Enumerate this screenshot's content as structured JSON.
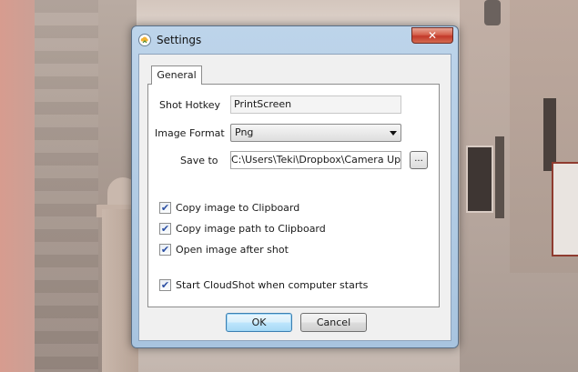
{
  "window": {
    "title": "Settings",
    "close_glyph": "✕"
  },
  "tabs": [
    {
      "label": "General",
      "selected": true
    }
  ],
  "general": {
    "shot_hotkey": {
      "label": "Shot Hotkey",
      "value": "PrintScreen"
    },
    "image_format": {
      "label": "Image Format",
      "value": "Png"
    },
    "save_to": {
      "label": "Save to",
      "value": "C:\\Users\\Teki\\Dropbox\\Camera Uploads",
      "browse_label": "..."
    },
    "options": [
      {
        "label": "Copy image to Clipboard",
        "checked": true
      },
      {
        "label": "Copy image path to Clipboard",
        "checked": true
      },
      {
        "label": "Open image after shot",
        "checked": true
      },
      {
        "label": "Start CloudShot when computer starts",
        "checked": true
      }
    ]
  },
  "buttons": {
    "ok": "OK",
    "cancel": "Cancel"
  },
  "check_glyph": "✔",
  "colors": {
    "title_bar": "#a8c4df",
    "close_button": "#c2392a",
    "default_button_border": "#3c7fb1"
  }
}
